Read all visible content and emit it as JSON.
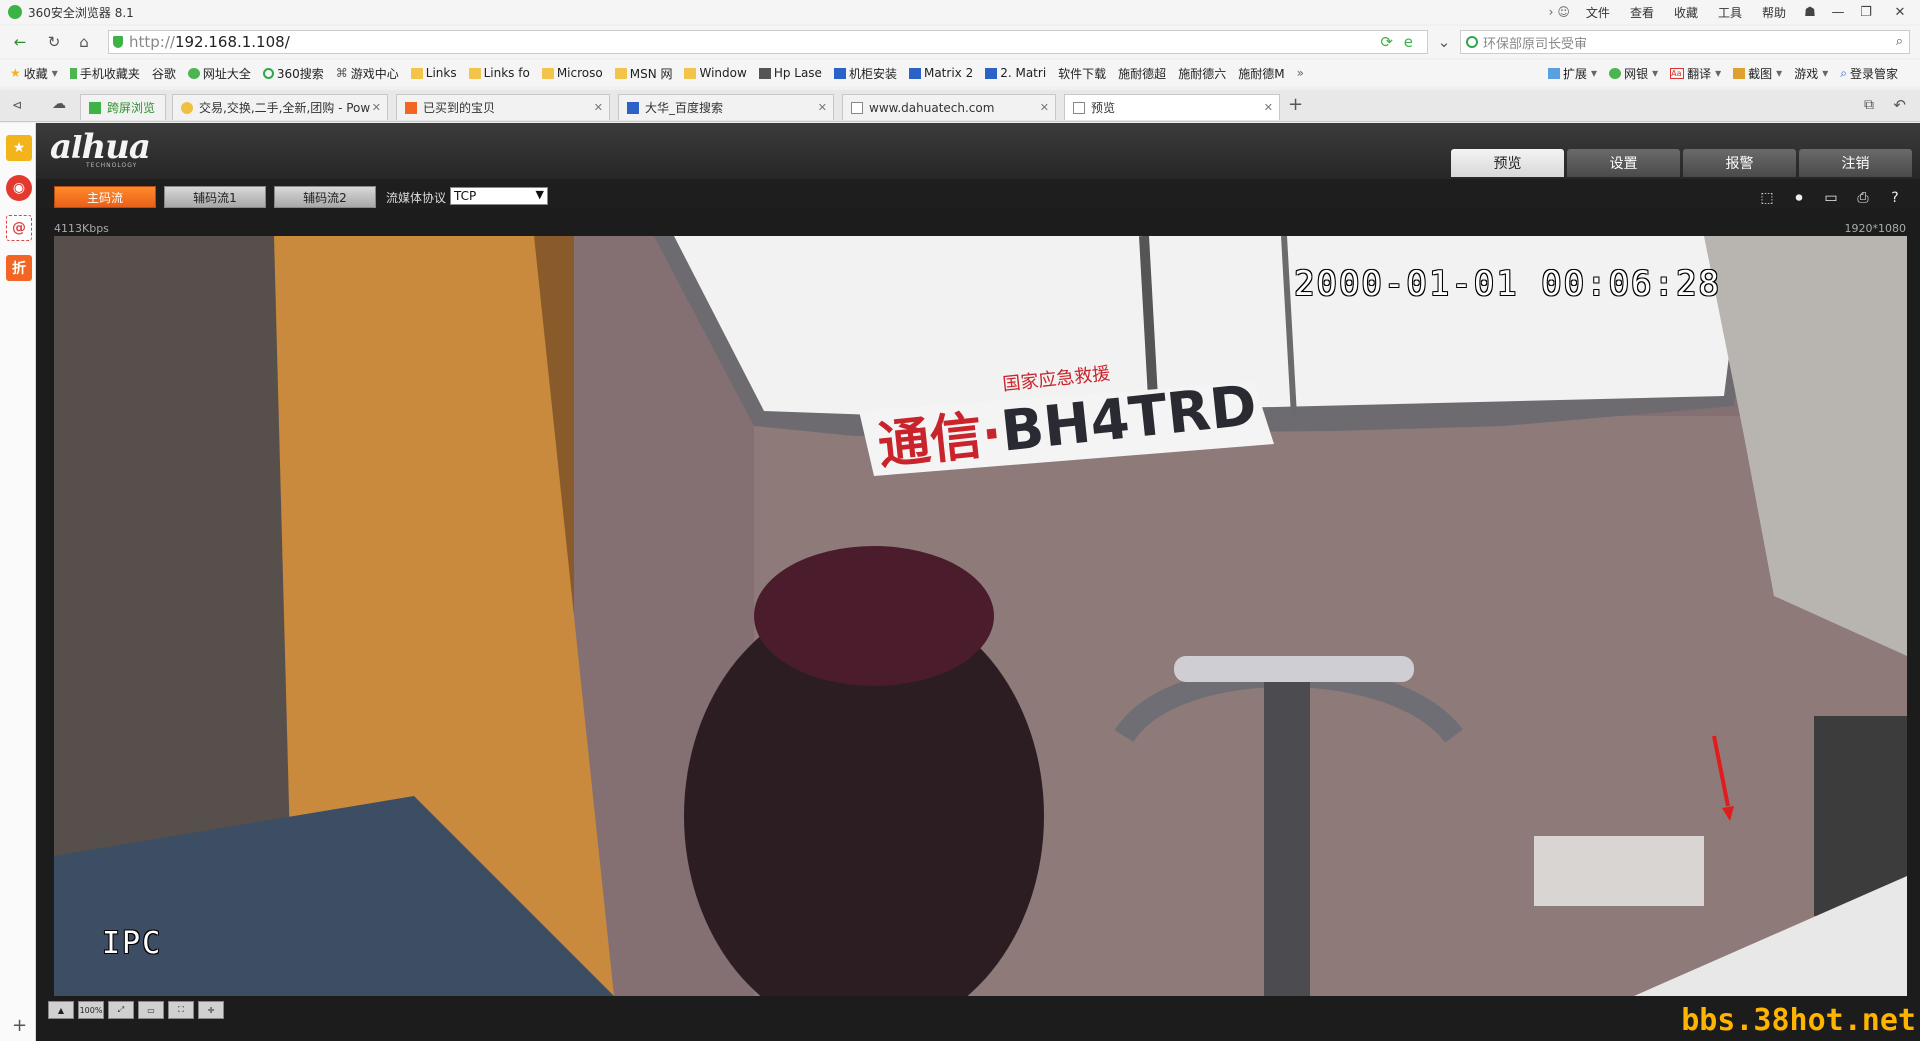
{
  "browser": {
    "app_title": "360安全浏览器 8.1",
    "menu": [
      "文件",
      "查看",
      "收藏",
      "工具",
      "帮助"
    ],
    "url_scheme": "http://",
    "url_host": "192.168.1.108/",
    "search_text": "环保部原司长受审"
  },
  "bookmarks": {
    "left": [
      "收藏",
      "手机收藏夹",
      "谷歌",
      "网址大全",
      "360搜索",
      "游戏中心",
      "Links",
      "Links fo",
      "Microso",
      "MSN 网",
      "Window",
      "Hp Lase",
      "机柜安装",
      "Matrix 2",
      "2. Matri",
      "软件下载",
      "施耐德超",
      "施耐德六",
      "施耐德M"
    ],
    "right": [
      "扩展",
      "网银",
      "翻译",
      "截图",
      "游戏",
      "登录管家"
    ]
  },
  "tabs": [
    {
      "label": "跨屏浏览"
    },
    {
      "label": "交易,交换,二手,全新,团购 - Pow"
    },
    {
      "label": "已买到的宝贝"
    },
    {
      "label": "大华_百度搜索"
    },
    {
      "label": "www.dahuatech.com"
    },
    {
      "label": "预览"
    }
  ],
  "dahua": {
    "logo": "a hua",
    "logo_sub": "TECHNOLOGY",
    "nav": [
      "预览",
      "设置",
      "报警",
      "注销"
    ],
    "streams": [
      "主码流",
      "辅码流1",
      "辅码流2"
    ],
    "protocol_label": "流媒体协议",
    "protocol_value": "TCP",
    "bitrate": "4113Kbps",
    "resolution": "1920*1080",
    "osd_time": "2000-01-01 00:06:28",
    "osd_name": "IPC",
    "plate_small": "国家应急救援",
    "plate_big": "通信·",
    "plate_code": "BH4TRD",
    "bottom_tools": [
      "",
      "100%",
      "",
      "",
      "",
      ""
    ]
  },
  "watermark": "bbs.38hot.net",
  "colors": {
    "accent_orange": "#ff7a22",
    "header_dark": "#2b2b2b",
    "plate_red": "#c9232b"
  }
}
